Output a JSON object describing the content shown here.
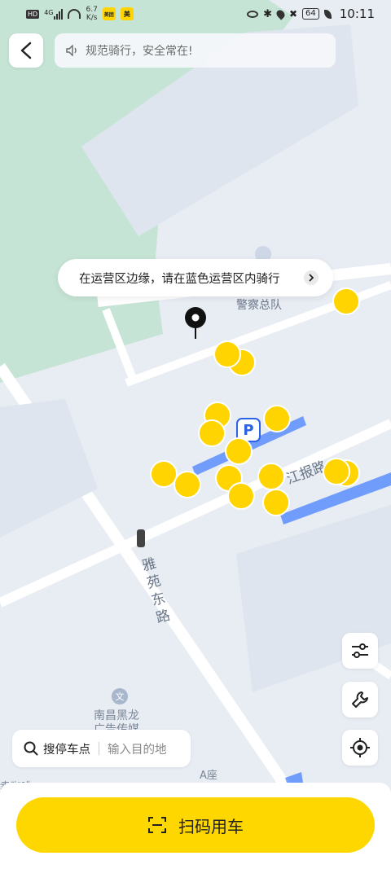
{
  "status_bar": {
    "network_badge": "HD",
    "signal_type": "4G",
    "speed_value": "6.7",
    "speed_unit": "K/s",
    "app_icon_1": "美团",
    "app_icon_2": "美",
    "battery": "64",
    "time": "10:11"
  },
  "top": {
    "notice_text": "规范骑行，安全常在!"
  },
  "map": {
    "tip_text": "在运营区边缘，请在蓝色运营区内骑行",
    "poi_police": "警察总队",
    "road_jiangbao": "江报路",
    "road_yayuan": "雅苑东路",
    "poi_culture_line1": "南昌黑龙",
    "poi_culture_line2": "广告传媒",
    "poi_building": "A座",
    "poi_partial": "幸咖啡",
    "parking_label": "P"
  },
  "search": {
    "label": "搜停车点",
    "destination_placeholder": "输入目的地"
  },
  "bottom": {
    "scan_label": "扫码用车"
  },
  "colors": {
    "accent_yellow": "#ffd700",
    "operating_zone_blue": "#3d7bff",
    "green_zone": "#bfe3cf"
  },
  "icons": [
    "back-arrow-icon",
    "speaker-icon",
    "chevron-right-icon",
    "filter-icon",
    "wrench-icon",
    "locate-icon",
    "search-icon",
    "scan-icon",
    "location-pin-icon",
    "traffic-light-icon",
    "scooter-icon",
    "parking-icon"
  ]
}
